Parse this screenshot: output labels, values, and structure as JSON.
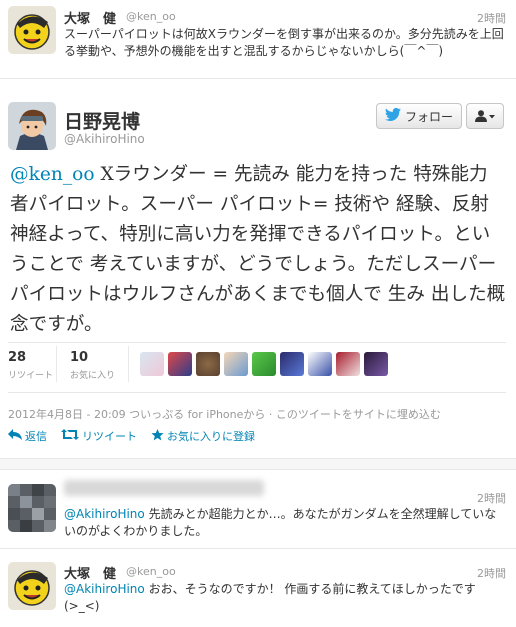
{
  "tweet1": {
    "name": "大塚　健",
    "handle": "@ken_oo",
    "time": "2時間",
    "text": "スーパーパイロットは何故Xラウンダーを倒す事が出来るのか。多分先読みを上回る挙動や、予想外の機能を出すと混乱するからじゃないかしら(￣^￣)"
  },
  "main": {
    "name": "日野晃博",
    "handle": "@AkihiroHino",
    "follow_label": "フォロー",
    "mention": "@ken_oo",
    "text": " Xラウンダー = 先読み 能力を持った 特殊能力者パイロット。スーパー パイロット= 技術や 経験、反射神経よって、特別に高い力を発揮できるパイロット。ということで 考えていますが、どうでしょう。ただしスーパー パイロットはウルフさんがあくまでも個人で 生み 出した概念ですが。",
    "retweet_count": "28",
    "retweet_label": "リツイート",
    "fav_count": "10",
    "fav_label": "お気に入り",
    "timestamp": "2012年4月8日 - 20:09 ついっぷる for iPhoneから · このツイートをサイトに埋め込む",
    "reply_label": "返信",
    "rt_label": "リツイート",
    "favorite_label": "お気に入りに登録"
  },
  "reply1": {
    "time": "2時間",
    "mention": "@AkihiroHino",
    "text": " 先読みとか超能力とか…。あなたがガンダムを全然理解していないのがよくわかりました。"
  },
  "reply2": {
    "name": "大塚　健",
    "handle": "@ken_oo",
    "time": "2時間",
    "mention": "@AkihiroHino",
    "text": " おお、そうなのですか！ 作画する前に教えてほしかったです(>_<)"
  },
  "colors": {
    "link": "#0084b4",
    "muted": "#999999",
    "text": "#333333"
  }
}
